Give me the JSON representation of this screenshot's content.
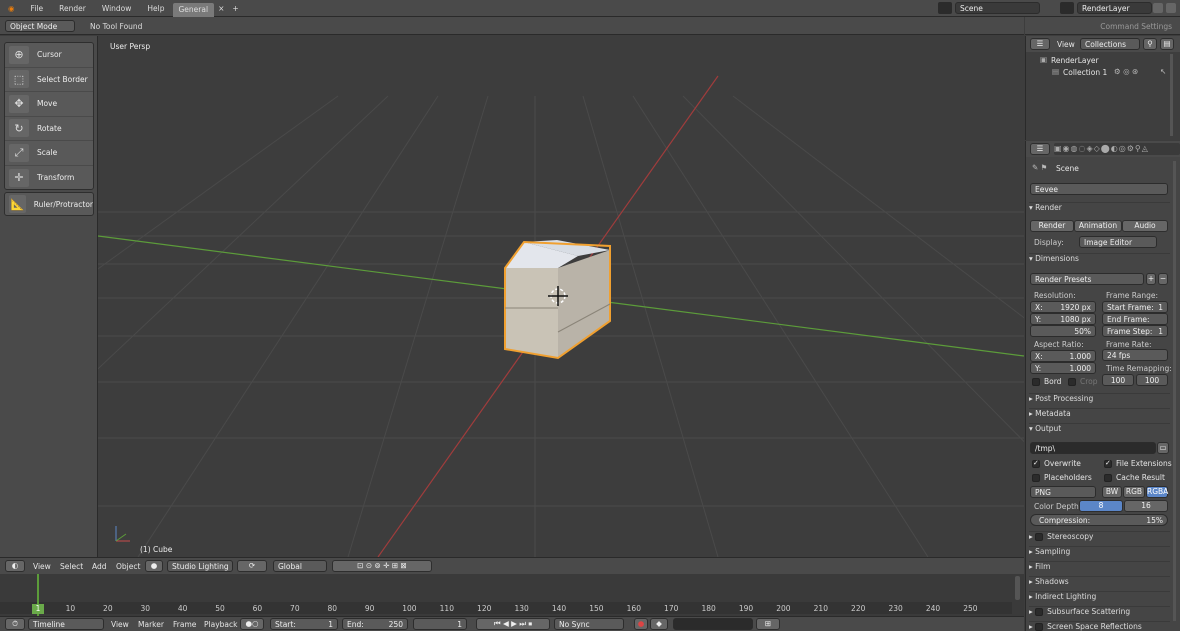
{
  "topbar": {
    "menus": [
      "File",
      "Render",
      "Window",
      "Help"
    ],
    "tab": "General",
    "tab_close": "×",
    "tab_add": "+",
    "scene": "Scene",
    "render_layer": "RenderLayer",
    "command_settings": "Command Settings"
  },
  "header": {
    "mode": "Object Mode",
    "tool_status": "No Tool Found"
  },
  "tools": {
    "items": [
      {
        "label": "Cursor",
        "icon": "⊕"
      },
      {
        "label": "Select Border",
        "icon": "⬚"
      },
      {
        "label": "Move",
        "icon": "✥"
      },
      {
        "label": "Rotate",
        "icon": "↻"
      },
      {
        "label": "Scale",
        "icon": "⤢"
      },
      {
        "label": "Transform",
        "icon": "✛"
      }
    ],
    "ruler": "Ruler/Protractor"
  },
  "viewport": {
    "title": "User Persp",
    "object": "(1) Cube"
  },
  "view_header": {
    "menus": [
      "View",
      "Select",
      "Add",
      "Object"
    ],
    "shading": "Studio Lighting",
    "orientation": "Global"
  },
  "timeline": {
    "ticks": [
      "1",
      "10",
      "20",
      "30",
      "40",
      "50",
      "60",
      "70",
      "80",
      "90",
      "100",
      "110",
      "120",
      "130",
      "140",
      "150",
      "160",
      "170",
      "180",
      "190",
      "200",
      "210",
      "220",
      "230",
      "240",
      "250"
    ],
    "current": "1"
  },
  "timeline_header": {
    "editor": "Timeline",
    "menus": [
      "View",
      "Marker",
      "Frame",
      "Playback"
    ],
    "start_label": "Start:",
    "start": "1",
    "end_label": "End:",
    "end": "250",
    "frame": "1",
    "sync": "No Sync"
  },
  "outliner": {
    "view": "View",
    "collections": "Collections",
    "render_layer": "RenderLayer",
    "collection": "Collection 1"
  },
  "props": {
    "scene": "Scene",
    "engine": "Eevee",
    "render": {
      "title": "Render",
      "render_btn": "Render",
      "animation_btn": "Animation",
      "audio_btn": "Audio",
      "display_label": "Display:",
      "display": "Image Editor"
    },
    "dimensions": {
      "title": "Dimensions",
      "presets": "Render Presets",
      "resolution": "Resolution:",
      "res_x_l": "X:",
      "res_x": "1920 px",
      "res_y_l": "Y:",
      "res_y": "1080 px",
      "pct": "50%",
      "frame_range": "Frame Range:",
      "start": "Start Frame:",
      "start_v": "1",
      "end": "End Frame:",
      "end_v": "250",
      "step": "Frame Step:",
      "step_v": "1",
      "aspect": "Aspect Ratio:",
      "ax_l": "X:",
      "ax": "1.000",
      "ay_l": "Y:",
      "ay": "1.000",
      "frame_rate": "Frame Rate:",
      "fps": "24 fps",
      "remap": "Time Remapping:",
      "remap_old": "100",
      "remap_new": "100",
      "bord": "Bord",
      "crop": "Crop"
    },
    "post": "Post Processing",
    "metadata": "Metadata",
    "output": {
      "title": "Output",
      "path": "/tmp\\",
      "overwrite": "Overwrite",
      "file_ext": "File Extensions",
      "placeholders": "Placeholders",
      "cache": "Cache Result",
      "format": "PNG",
      "bw": "BW",
      "rgb": "RGB",
      "rgba": "RGBA",
      "depth_label": "Color Depth:",
      "d8": "8",
      "d16": "16",
      "compression": "Compression:",
      "comp_v": "15%"
    },
    "sections": [
      "Stereoscopy",
      "Sampling",
      "Film",
      "Shadows",
      "Indirect Lighting",
      "Subsurface Scattering",
      "Screen Space Reflections"
    ]
  }
}
